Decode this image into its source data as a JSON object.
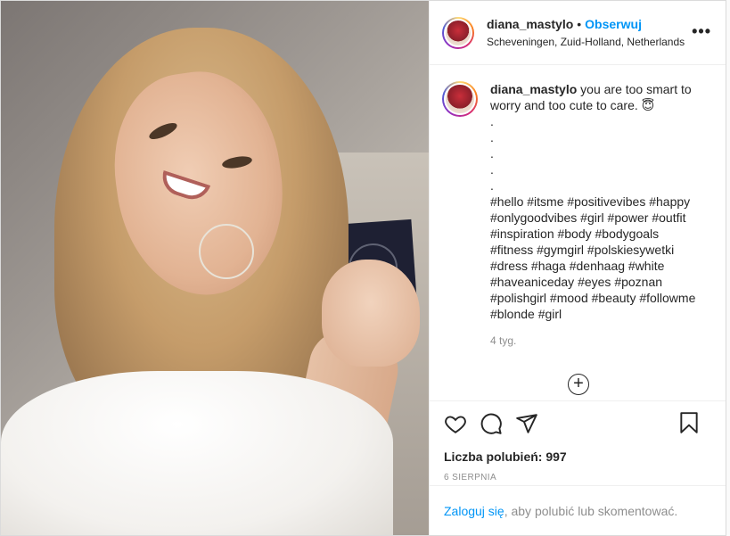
{
  "header": {
    "username": "diana_mastylo",
    "separator": "•",
    "follow_label": "Obserwuj",
    "location": "Scheveningen, Zuid-Holland, Netherlands",
    "more_label": "•••"
  },
  "caption": {
    "username": "diana_mastylo",
    "text": " you are too smart to worry and too cute to care. 😇\n.\n.\n.\n.\n.\n#hello #itsme #positivevibes #happy #onlygoodvibes #girl #power #outfit #inspiration #body #bodygoals #fitness #gymgirl #polskiesywetki #dress #haga #denhaag #white #haveaniceday #eyes #poznan #polishgirl #mood #beauty #followme #blonde #girl",
    "time": "4 tyg.",
    "load_more": "+"
  },
  "actions": {
    "icons": [
      "heart-icon",
      "comment-icon",
      "share-icon",
      "bookmark-icon"
    ],
    "likes_label": "Liczba polubień: 997",
    "date": "6 SIERPNIA"
  },
  "login": {
    "link": "Zaloguj się",
    "rest": ", aby polubić lub skomentować."
  },
  "colors": {
    "accent": "#0095f6",
    "text": "#262626",
    "muted": "#8e8e8e",
    "border": "#dbdbdb"
  }
}
